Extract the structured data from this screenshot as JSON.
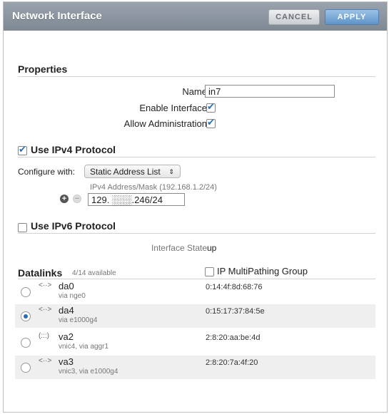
{
  "dialog": {
    "title": "Network Interface",
    "cancel_label": "CANCEL",
    "apply_label": "APPLY"
  },
  "properties": {
    "heading": "Properties",
    "name_label": "Name",
    "name_value": "in7",
    "enable_label": "Enable Interface",
    "enable_checked": true,
    "admin_label": "Allow Administration",
    "admin_checked": true
  },
  "ipv4": {
    "heading": "Use IPv4 Protocol",
    "checked": true,
    "configure_label": "Configure with:",
    "configure_value": "Static Address List",
    "address_hint": "IPv4 Address/Mask (192.168.1.2/24)",
    "address_value": "129. ░░░.246/24"
  },
  "ipv6": {
    "heading": "Use IPv6 Protocol",
    "checked": false
  },
  "interface_state": {
    "label": "Interface State",
    "value": "up"
  },
  "datalinks": {
    "heading": "Datalinks",
    "available": "4/14 available",
    "ipmp_label": "IP MultiPathing Group",
    "ipmp_checked": false,
    "items": [
      {
        "glyph": "<··>",
        "name": "da0",
        "via": "via nge0",
        "mac": "0:14:4f:8d:68:76",
        "selected": false
      },
      {
        "glyph": "<··>",
        "name": "da4",
        "via": "via e1000g4",
        "mac": "0:15:17:37:84:5e",
        "selected": true
      },
      {
        "glyph": "(:::)",
        "name": "va2",
        "via": "vnic4, via aggr1",
        "mac": "2:8:20:aa:be:4d",
        "selected": false
      },
      {
        "glyph": "<··>",
        "name": "va3",
        "via": "vnic3, via e1000g4",
        "mac": "2:8:20:7a:4f:20",
        "selected": false
      }
    ]
  }
}
